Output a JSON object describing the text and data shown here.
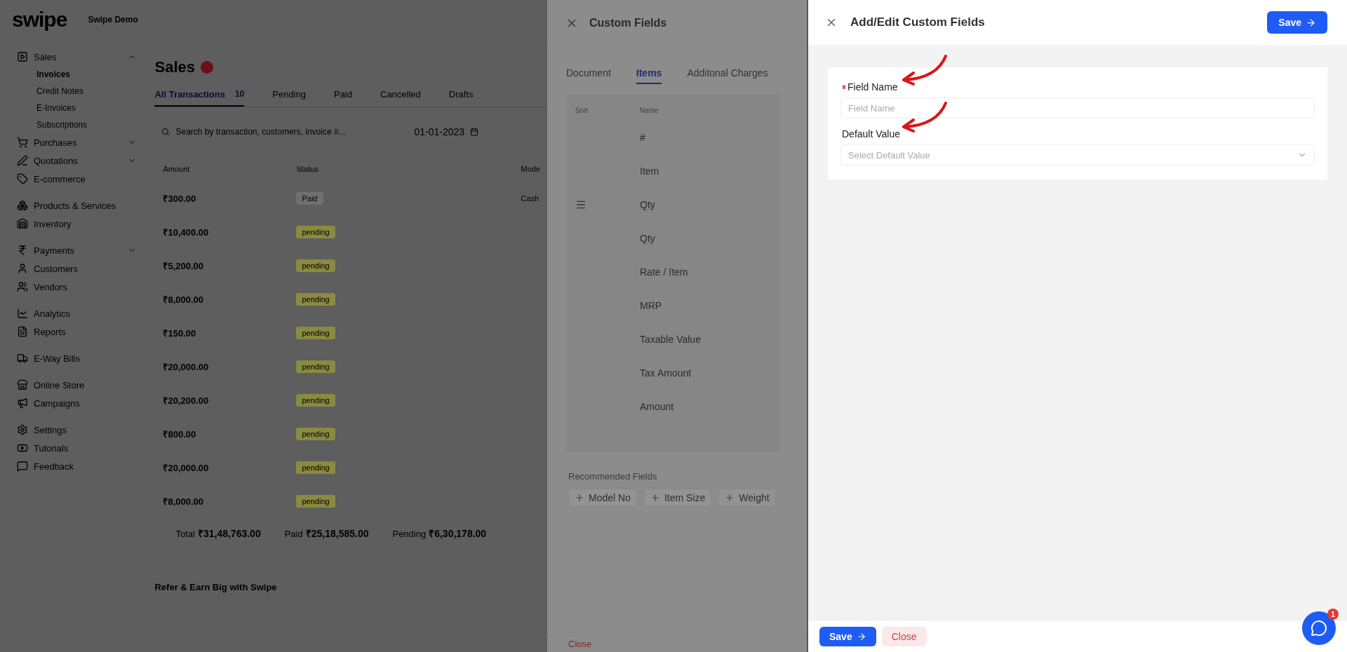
{
  "app": {
    "logo": "swipe",
    "company": "Swipe Demo",
    "sidebar": [
      [
        {
          "label": "Sales",
          "expanded": true,
          "children": [
            {
              "label": "Invoices",
              "selected": true
            },
            {
              "label": "Credit Notes",
              "selected": false
            },
            {
              "label": "E-Invoices",
              "selected": false
            },
            {
              "label": "Subscriptions",
              "selected": false
            }
          ]
        },
        {
          "label": "Purchases",
          "expanded": false
        },
        {
          "label": "Quotations",
          "expanded": false
        },
        {
          "label": "E-commerce"
        }
      ],
      [
        {
          "label": "Products & Services"
        },
        {
          "label": "Inventory"
        }
      ],
      [
        {
          "label": "Payments",
          "expanded": false
        },
        {
          "label": "Customers"
        },
        {
          "label": "Vendors"
        }
      ],
      [
        {
          "label": "Analytics"
        },
        {
          "label": "Reports"
        }
      ],
      [
        {
          "label": "E-Way Bills"
        }
      ],
      [
        {
          "label": "Online Store"
        },
        {
          "label": "Campaigns"
        }
      ],
      [
        {
          "label": "Settings"
        },
        {
          "label": "Tutorials"
        },
        {
          "label": "Feedback"
        }
      ]
    ],
    "page": {
      "title": "Sales",
      "tabs": [
        {
          "label": "All Transactions",
          "count": "10",
          "selected": true
        },
        {
          "label": "Pending",
          "selected": false
        },
        {
          "label": "Paid",
          "selected": false
        },
        {
          "label": "Cancelled",
          "selected": false
        },
        {
          "label": "Drafts",
          "selected": false
        }
      ],
      "search": {
        "placeholder": "Search by transaction, customers, invoice #..."
      },
      "date": "01-01-2023",
      "columns": [
        "Amount",
        "Status",
        "Mode"
      ],
      "rows": [
        {
          "amount": "₹300.00",
          "status": "Paid",
          "kind": "paid",
          "mode": "Cash"
        },
        {
          "amount": "₹10,400.00",
          "status": "pending",
          "kind": "pending"
        },
        {
          "amount": "₹5,200.00",
          "status": "pending",
          "kind": "pending"
        },
        {
          "amount": "₹8,000.00",
          "status": "pending",
          "kind": "pending"
        },
        {
          "amount": "₹150.00",
          "status": "pending",
          "kind": "pending"
        },
        {
          "amount": "₹20,000.00",
          "status": "pending",
          "kind": "pending"
        },
        {
          "amount": "₹20,200.00",
          "status": "pending",
          "kind": "pending"
        },
        {
          "amount": "₹800.00",
          "status": "pending",
          "kind": "pending"
        },
        {
          "amount": "₹20,000.00",
          "status": "pending",
          "kind": "pending"
        },
        {
          "amount": "₹8,000.00",
          "status": "pending",
          "kind": "pending"
        }
      ],
      "totals": [
        {
          "label": "Total",
          "value": "₹31,48,763.00"
        },
        {
          "label": "Paid",
          "value": "₹25,18,585.00"
        },
        {
          "label": "Pending",
          "value": "₹6,30,178.00"
        }
      ],
      "refer": {
        "title": "Refer & Earn Big with Swipe"
      }
    }
  },
  "custom_fields": {
    "title": "Custom Fields",
    "tabs": [
      {
        "label": "Document",
        "selected": false
      },
      {
        "label": "Items",
        "selected": true
      },
      {
        "label": "Additonal Charges",
        "selected": false
      }
    ],
    "columns": [
      "Sort",
      "Name"
    ],
    "rows": [
      {
        "name": "#",
        "handle": false
      },
      {
        "name": "Item",
        "handle": false
      },
      {
        "name": "Qty",
        "handle": true
      },
      {
        "name": "Qty",
        "handle": false
      },
      {
        "name": "Rate / Item",
        "handle": false
      },
      {
        "name": "MRP",
        "handle": false
      },
      {
        "name": "Taxable Value",
        "handle": false
      },
      {
        "name": "Tax Amount",
        "handle": false
      },
      {
        "name": "Amount",
        "handle": false
      }
    ],
    "recommended_title": "Recommended Fields",
    "recommended": [
      "Model No",
      "Item Size",
      "Weight"
    ],
    "close": "Close"
  },
  "editor": {
    "title": "Add/Edit Custom Fields",
    "save": "Save",
    "fields": [
      {
        "label": "Field Name",
        "required": true,
        "kind": "text",
        "placeholder": "Field Name"
      },
      {
        "label": "Default Value",
        "required": false,
        "kind": "select",
        "placeholder": "Select Default Value"
      }
    ],
    "footer_save": "Save",
    "footer_close": "Close"
  },
  "chat": {
    "badge": "1"
  }
}
